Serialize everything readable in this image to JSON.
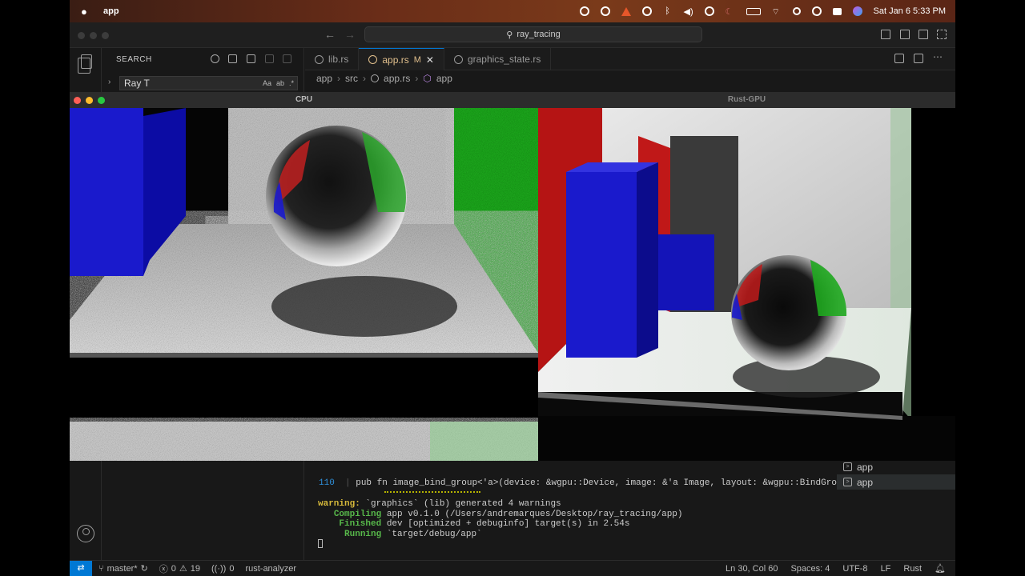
{
  "menubar": {
    "app_name": "app",
    "clock": "Sat Jan 6  5:33 PM"
  },
  "titlebar": {
    "search_text": "ray_tracing"
  },
  "sidebar": {
    "title": "SEARCH",
    "search_value": "Ray T",
    "option_case": "Aa",
    "option_word": "ab",
    "option_regex": ".*"
  },
  "tabs": [
    {
      "label": "lib.rs",
      "active": false
    },
    {
      "label": "app.rs",
      "active": true,
      "modified_marker": "M"
    },
    {
      "label": "graphics_state.rs",
      "active": false
    }
  ],
  "breadcrumb": [
    "app",
    "src",
    "app.rs",
    "app"
  ],
  "windows": {
    "cpu_title": "CPU",
    "gpu_title": "Rust-GPU"
  },
  "editor": {
    "line_number": "110",
    "code": "pub fn image_bind_group<'a>(device: &wgpu::Device, image: &'a Image, layout: &wgpu::BindGro..."
  },
  "terminal": {
    "warning_label": "warning:",
    "warning_text": " `graphics` (lib) generated 4 warnings",
    "compiling_label": "Compiling",
    "compiling_text": " app v0.1.0 (/Users/andremarques/Desktop/ray_tracing/app)",
    "finished_label": "Finished",
    "finished_text": " dev [optimized + debuginfo] target(s) in 2.54s",
    "running_label": "Running",
    "running_text": " `target/debug/app`",
    "tabs": [
      "app",
      "app"
    ]
  },
  "statusbar": {
    "branch": "master*",
    "errors": "0",
    "warnings": "19",
    "ports": "0",
    "lsp": "rust-analyzer",
    "position": "Ln 30, Col 60",
    "spaces": "Spaces: 4",
    "encoding": "UTF-8",
    "eol": "LF",
    "language": "Rust"
  }
}
